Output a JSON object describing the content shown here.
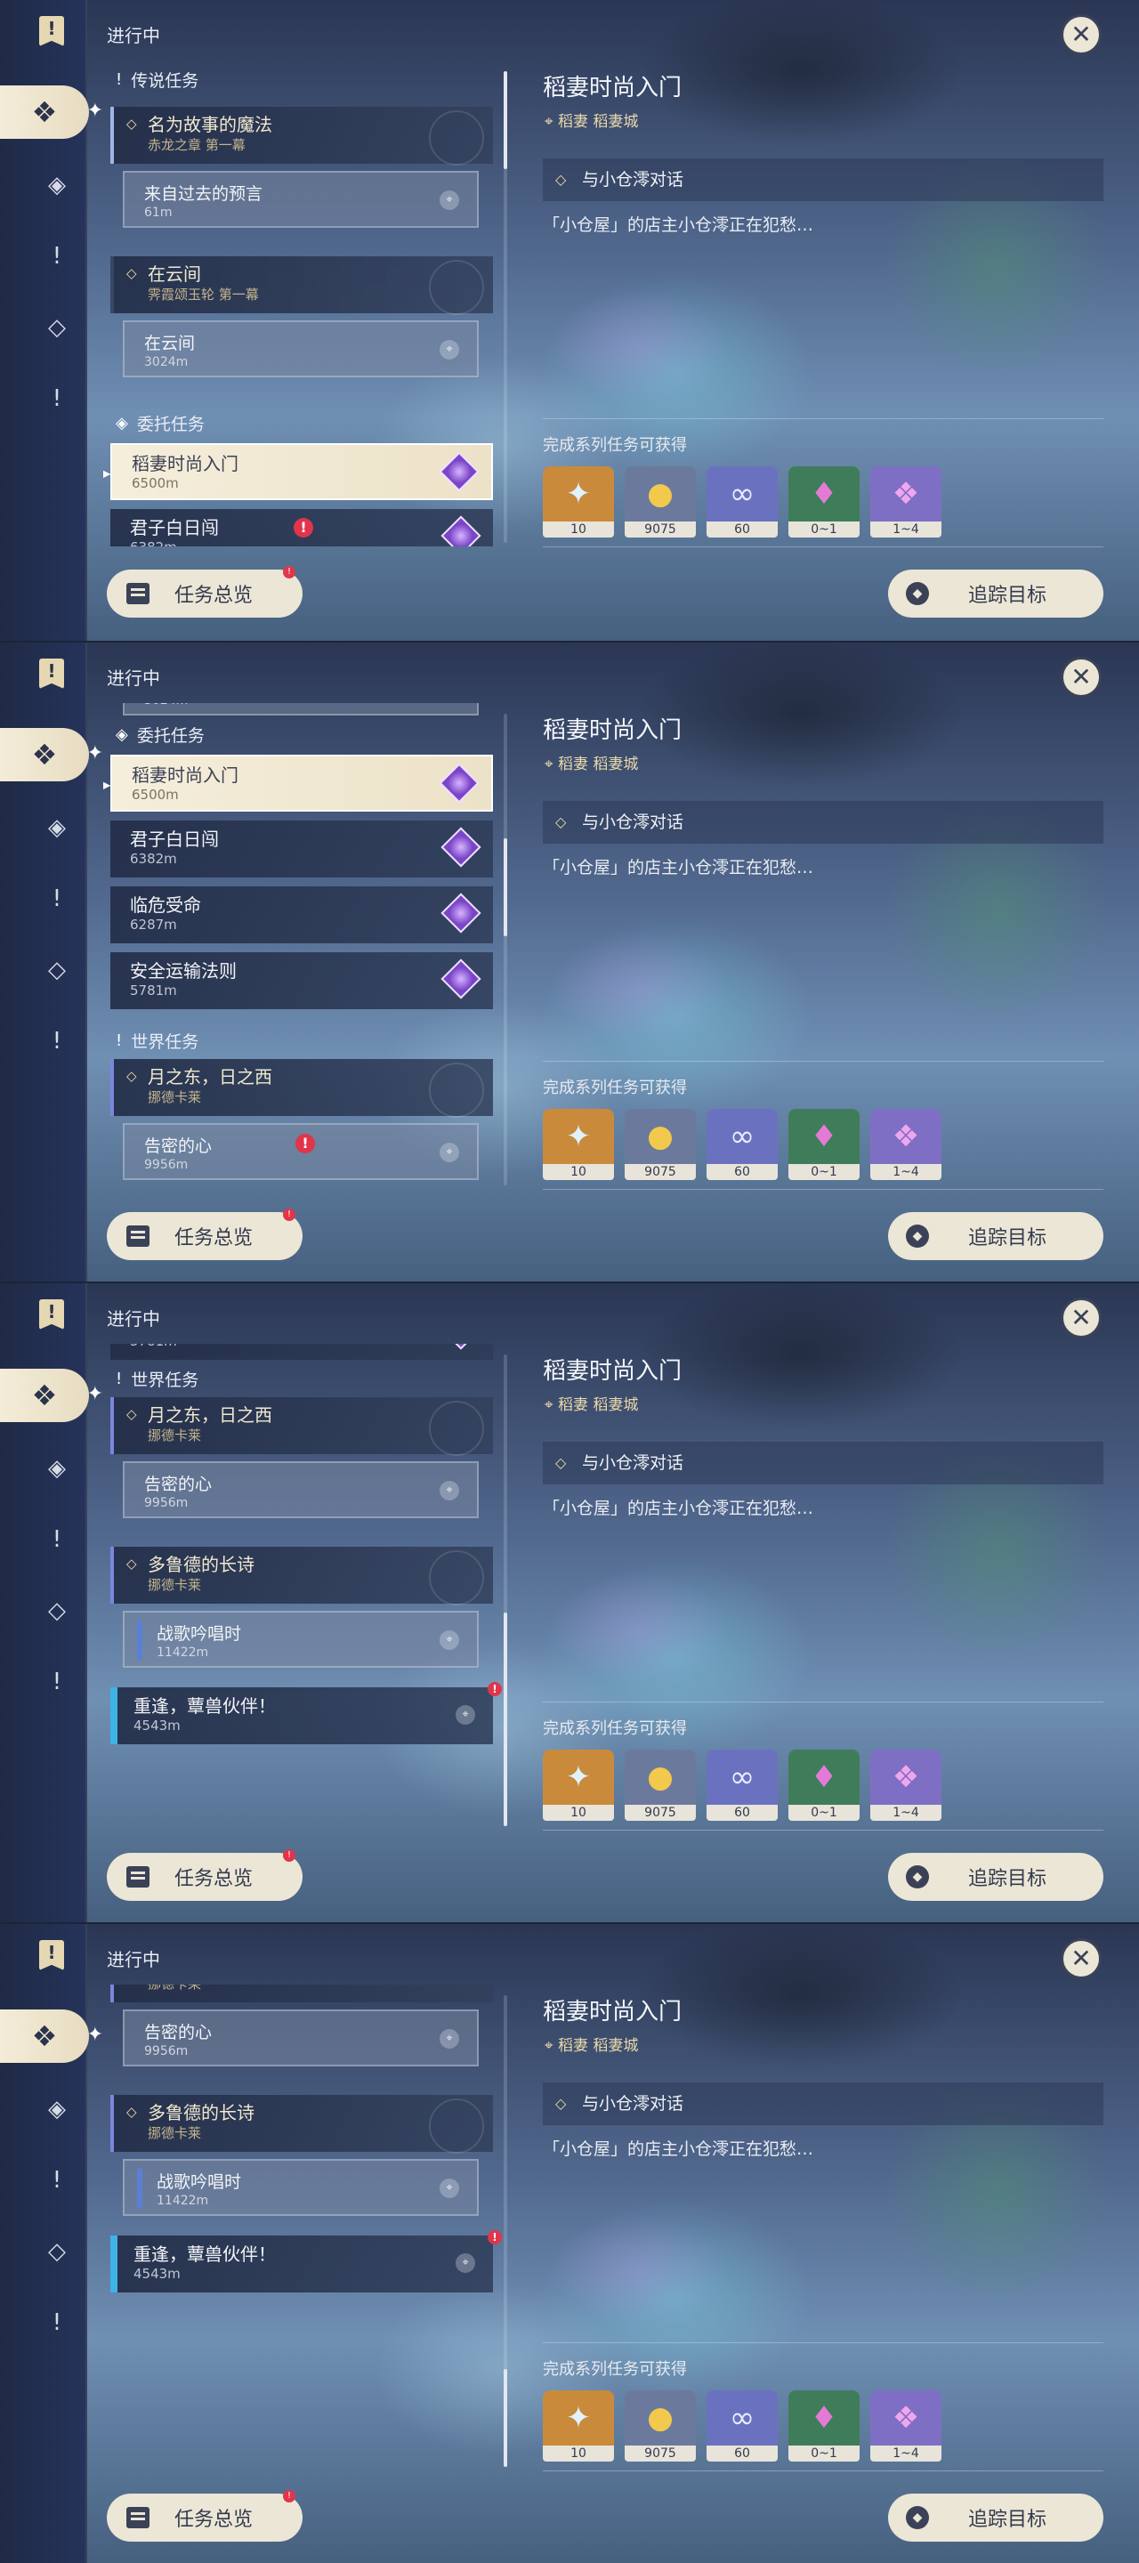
{
  "header": {
    "ongoing": "进行中"
  },
  "sections": {
    "legend": "传说任务",
    "commission": "委托任务",
    "world": "世界任务"
  },
  "quests": {
    "q1": {
      "name": "名为故事的魔法",
      "chapter": "赤龙之章 第一幕"
    },
    "q1_sub": {
      "name": "来自过去的预言",
      "dist": "61m"
    },
    "q2": {
      "name": "在云间",
      "chapter": "霁霞颂玉轮 第一幕"
    },
    "q2_sub": {
      "name": "在云间",
      "dist": "3024m"
    },
    "c1": {
      "name": "稻妻时尚入门",
      "dist": "6500m"
    },
    "c2": {
      "name": "君子白日闯",
      "dist": "6382m"
    },
    "c3": {
      "name": "临危受命",
      "dist": "6287m"
    },
    "c4": {
      "name": "安全运输法则",
      "dist": "5781m"
    },
    "w1": {
      "name": "月之东，日之西",
      "chapter": "挪德卡莱"
    },
    "w1_sub": {
      "name": "告密的心",
      "dist": "9956m"
    },
    "w2": {
      "name": "多鲁德的长诗",
      "chapter": "挪德卡莱"
    },
    "w2_sub": {
      "name": "战歌吟唱时",
      "dist": "11422m"
    },
    "w3": {
      "name": "重逢，蕈兽伙伴！",
      "dist": "4543m"
    }
  },
  "detail": {
    "title": "稻妻时尚入门",
    "location": "稻妻 稻妻城",
    "objective": "与小仓澪对话",
    "description": "「小仓屋」的店主小仓澪正在犯愁…",
    "reward_label": "完成系列任务可获得",
    "rewards": [
      {
        "icon": "primogem-icon",
        "count": "10",
        "color": "#c98a3c"
      },
      {
        "icon": "mora-icon",
        "count": "9075",
        "color": "#6b7a9c"
      },
      {
        "icon": "fetters-icon",
        "count": "60",
        "color": "#6a72c0"
      },
      {
        "icon": "crystal-icon",
        "count": "0~1",
        "color": "#3f7d5a"
      },
      {
        "icon": "crystal-cluster-icon",
        "count": "1~4",
        "color": "#7e6fc4"
      }
    ]
  },
  "buttons": {
    "overview": "任务总览",
    "track": "追踪目标",
    "close": "✕"
  },
  "alerts": {
    "mark": "!"
  }
}
